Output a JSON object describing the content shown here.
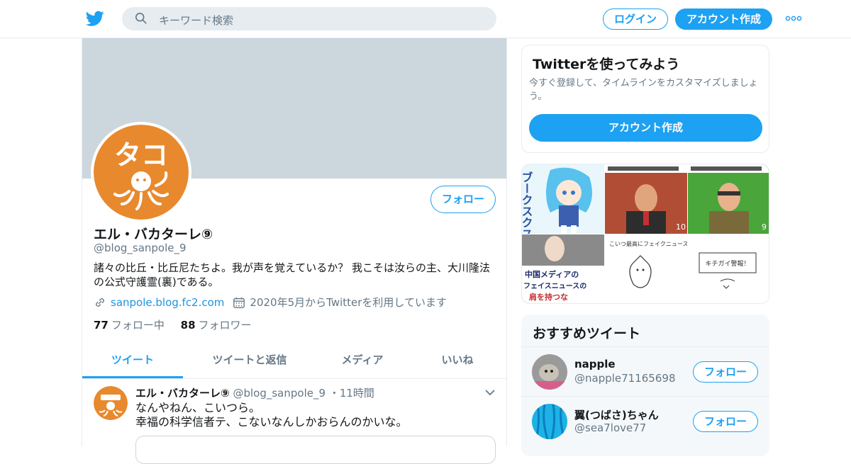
{
  "header": {
    "search_placeholder": "キーワード検索",
    "login_label": "ログイン",
    "signup_label": "アカウント作成"
  },
  "profile": {
    "name": "エル・バカターレ⑨",
    "handle": "@blog_sanpole_9",
    "bio": "諸々の比丘・比丘尼たちよ。我が声を覚えているか？ 我こそは汝らの主、大川隆法の公式守護霊(裏)である。",
    "website": "sanpole.blog.fc2.com",
    "joined": "2020年5月からTwitterを利用しています",
    "following_count": "77",
    "following_label": "フォロー中",
    "followers_count": "88",
    "followers_label": "フォロワー",
    "follow_button": "フォロー",
    "avatar_text": "タコ"
  },
  "tabs": [
    "ツイート",
    "ツイートと返信",
    "メディア",
    "いいね"
  ],
  "tweet": {
    "name": "エル・バカターレ⑨",
    "handle": "@blog_sanpole_9",
    "time": "11時間",
    "line1": "なんやねん、こいつら。",
    "line2": "幸福の科学信者テ、こないなんしかおらんのかいな。"
  },
  "signup_card": {
    "title": "Twitterを使ってみよう",
    "desc": "今すぐ登録して、タイムラインをカスタマイズしましょう。",
    "button": "アカウント作成"
  },
  "media": {
    "cell1_text": "ブークスクス",
    "cell2_badge": "10",
    "cell3_badge": "9",
    "cell4_text1": "中国メディアの",
    "cell4_text2": "フェイスニュースの",
    "cell4_text3": "肩を持つな",
    "cell5_text": "こいつ最高にフェイクニュース",
    "cell6_text": "キチガイ警報！"
  },
  "recommended": {
    "title": "おすすめツイート",
    "items": [
      {
        "name": "napple",
        "handle": "@napple71165698",
        "button": "フォロー"
      },
      {
        "name": "翼(つばさ)ちゃん",
        "handle": "@sea7love77",
        "button": "フォロー"
      }
    ]
  },
  "colors": {
    "accent": "#1da1f2",
    "avatar_orange": "#e8892e"
  }
}
